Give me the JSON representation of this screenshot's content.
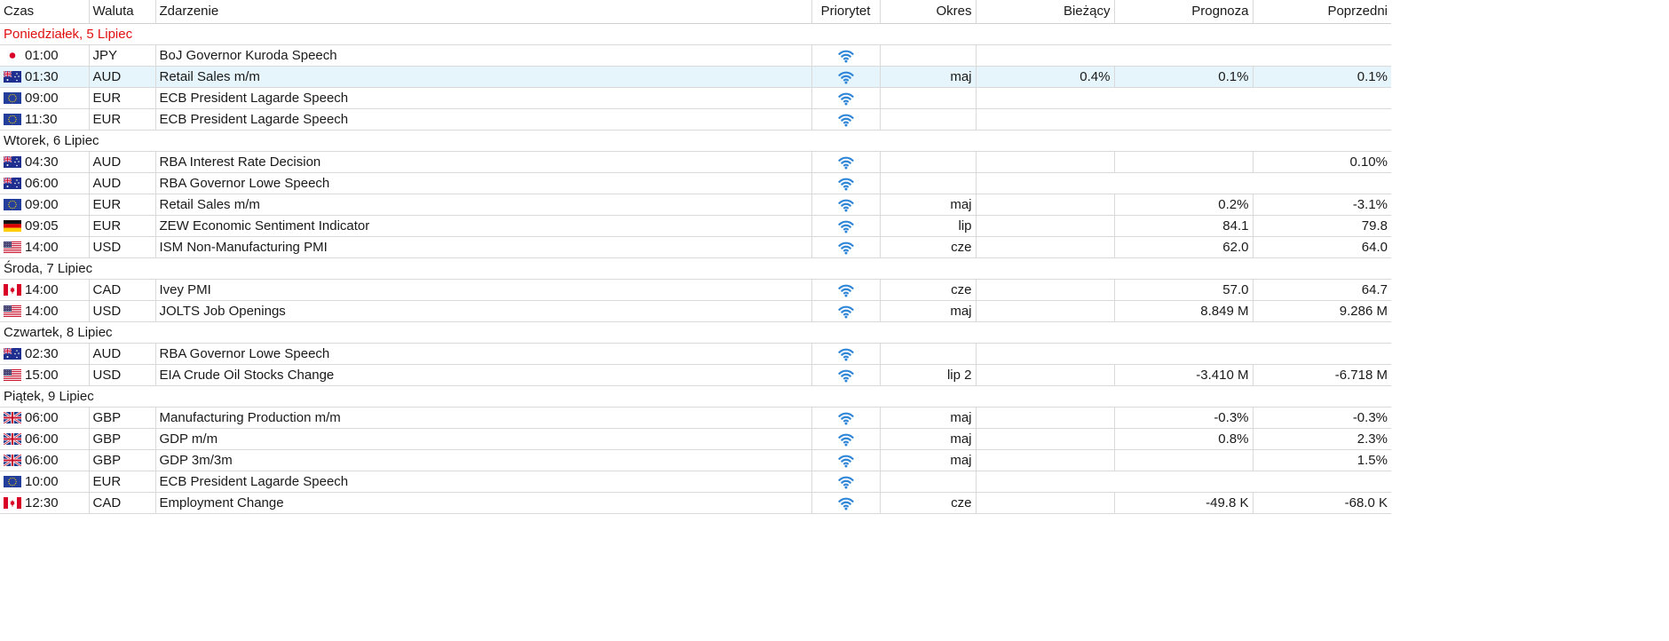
{
  "header": {
    "time": "Czas",
    "currency": "Waluta",
    "event": "Zdarzenie",
    "priority": "Priorytet",
    "period": "Okres",
    "actual": "Bieżący",
    "forecast": "Prognoza",
    "previous": "Poprzedni"
  },
  "colors": {
    "today_header": "#e01010",
    "selected_row": "#e6f5fb",
    "priority_icon": "#2f86d8"
  },
  "days": [
    {
      "label": "Poniedziałek, 5 Lipiec",
      "today": true,
      "events": [
        {
          "flag": "jp-flag-icon",
          "time": "01:00",
          "currency": "JPY",
          "event": "BoJ Governor Kuroda Speech",
          "period": "",
          "actual": "",
          "forecast": "",
          "previous": ""
        },
        {
          "flag": "au-flag-icon",
          "time": "01:30",
          "currency": "AUD",
          "event": "Retail Sales m/m",
          "period": "maj",
          "actual": "0.4%",
          "forecast": "0.1%",
          "previous": "0.1%",
          "selected": true
        },
        {
          "flag": "eu-flag-icon",
          "time": "09:00",
          "currency": "EUR",
          "event": "ECB President Lagarde Speech",
          "period": "",
          "actual": "",
          "forecast": "",
          "previous": ""
        },
        {
          "flag": "eu-flag-icon",
          "time": "11:30",
          "currency": "EUR",
          "event": "ECB President Lagarde Speech",
          "period": "",
          "actual": "",
          "forecast": "",
          "previous": ""
        }
      ]
    },
    {
      "label": "Wtorek, 6 Lipiec",
      "today": false,
      "events": [
        {
          "flag": "au-flag-icon",
          "time": "04:30",
          "currency": "AUD",
          "event": "RBA Interest Rate Decision",
          "period": "",
          "actual": "",
          "forecast": "",
          "previous": "0.10%"
        },
        {
          "flag": "au-flag-icon",
          "time": "06:00",
          "currency": "AUD",
          "event": "RBA Governor Lowe Speech",
          "period": "",
          "actual": "",
          "forecast": "",
          "previous": ""
        },
        {
          "flag": "eu-flag-icon",
          "time": "09:00",
          "currency": "EUR",
          "event": "Retail Sales m/m",
          "period": "maj",
          "actual": "",
          "forecast": "0.2%",
          "previous": "-3.1%"
        },
        {
          "flag": "de-flag-icon",
          "time": "09:05",
          "currency": "EUR",
          "event": "ZEW Economic Sentiment Indicator",
          "period": "lip",
          "actual": "",
          "forecast": "84.1",
          "previous": "79.8"
        },
        {
          "flag": "us-flag-icon",
          "time": "14:00",
          "currency": "USD",
          "event": "ISM Non-Manufacturing PMI",
          "period": "cze",
          "actual": "",
          "forecast": "62.0",
          "previous": "64.0"
        }
      ]
    },
    {
      "label": "Środa, 7 Lipiec",
      "today": false,
      "events": [
        {
          "flag": "ca-flag-icon",
          "time": "14:00",
          "currency": "CAD",
          "event": "Ivey PMI",
          "period": "cze",
          "actual": "",
          "forecast": "57.0",
          "previous": "64.7"
        },
        {
          "flag": "us-flag-icon",
          "time": "14:00",
          "currency": "USD",
          "event": "JOLTS Job Openings",
          "period": "maj",
          "actual": "",
          "forecast": "8.849 M",
          "previous": "9.286 M"
        }
      ]
    },
    {
      "label": "Czwartek, 8 Lipiec",
      "today": false,
      "events": [
        {
          "flag": "au-flag-icon",
          "time": "02:30",
          "currency": "AUD",
          "event": "RBA Governor Lowe Speech",
          "period": "",
          "actual": "",
          "forecast": "",
          "previous": ""
        },
        {
          "flag": "us-flag-icon",
          "time": "15:00",
          "currency": "USD",
          "event": "EIA Crude Oil Stocks Change",
          "period": "lip 2",
          "actual": "",
          "forecast": "-3.410 M",
          "previous": "-6.718 M"
        }
      ]
    },
    {
      "label": "Piątek, 9 Lipiec",
      "today": false,
      "events": [
        {
          "flag": "gb-flag-icon",
          "time": "06:00",
          "currency": "GBP",
          "event": "Manufacturing Production m/m",
          "period": "maj",
          "actual": "",
          "forecast": "-0.3%",
          "previous": "-0.3%"
        },
        {
          "flag": "gb-flag-icon",
          "time": "06:00",
          "currency": "GBP",
          "event": "GDP m/m",
          "period": "maj",
          "actual": "",
          "forecast": "0.8%",
          "previous": "2.3%"
        },
        {
          "flag": "gb-flag-icon",
          "time": "06:00",
          "currency": "GBP",
          "event": "GDP 3m/3m",
          "period": "maj",
          "actual": "",
          "forecast": "",
          "previous": "1.5%"
        },
        {
          "flag": "eu-flag-icon",
          "time": "10:00",
          "currency": "EUR",
          "event": "ECB President Lagarde Speech",
          "period": "",
          "actual": "",
          "forecast": "",
          "previous": ""
        },
        {
          "flag": "ca-flag-icon",
          "time": "12:30",
          "currency": "CAD",
          "event": "Employment Change",
          "period": "cze",
          "actual": "",
          "forecast": "-49.8 K",
          "previous": "-68.0 K"
        }
      ]
    }
  ]
}
